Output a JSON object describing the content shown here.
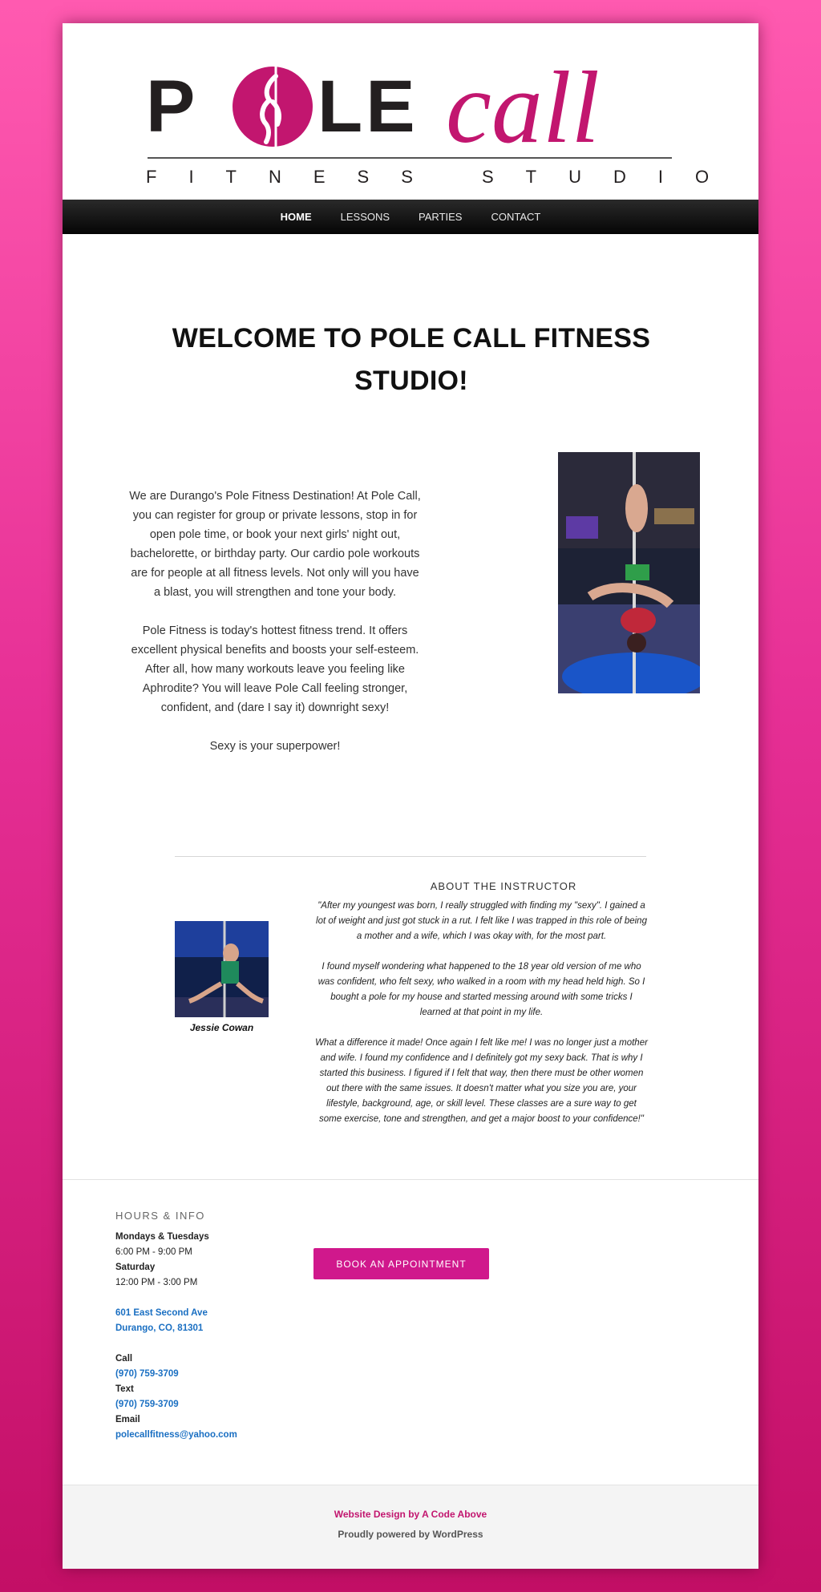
{
  "colors": {
    "brand_pink": "#c2166f",
    "button_pink": "#d0188c",
    "nav_bg": "#111111",
    "link_blue": "#1a6fc2"
  },
  "logo": {
    "word_pole": "POLE",
    "word_call": "call",
    "tagline": "FITNESS STUDIO"
  },
  "nav": {
    "items": [
      {
        "label": "HOME",
        "active": true
      },
      {
        "label": "LESSONS",
        "active": false
      },
      {
        "label": "PARTIES",
        "active": false
      },
      {
        "label": "CONTACT",
        "active": false
      }
    ]
  },
  "main": {
    "title": "WELCOME TO POLE CALL FITNESS STUDIO!",
    "intro": [
      "We are Durango's Pole Fitness Destination! At Pole Call, you can register for group or private lessons, stop in for open pole time, or book your next girls' night out, bachelorette, or birthday party. Our cardio pole workouts are for people at all fitness levels. Not only will you have a blast, you will strengthen and tone your body.",
      "Pole Fitness is today's hottest fitness trend. It offers excellent physical benefits and boosts your self-esteem. After all, how many workouts leave you feeling like Aphrodite? You will leave Pole Call feeling stronger, confident, and (dare I say it) downright sexy!",
      "Sexy is your superpower!"
    ]
  },
  "about": {
    "title": "ABOUT THE INSTRUCTOR",
    "instructor_name": "Jessie Cowan",
    "paragraphs": [
      "\"After my youngest was born, I really struggled with finding my \"sexy\". I gained a lot of weight and just got stuck in a rut. I felt like I was trapped in this role of being a mother and a wife, which I was okay with, for the most part.",
      "I found myself wondering what happened to the 18 year old version of me who was confident, who felt sexy, who walked in a room with my head held high. So I bought a pole for my house and started messing around with some tricks I learned at that point in my life.",
      "What a difference it made! Once again I felt like me! I was no longer just a mother and wife. I found my confidence and I definitely got my sexy back. That is why I started this business. I figured if I felt that way, then there must be other women out there with the same issues. It doesn't matter what you size you are, your lifestyle, background, age, or skill level. These classes are a sure way to get some exercise, tone and strengthen, and get a major boost to your confidence!\""
    ]
  },
  "hours": {
    "title": "HOURS & INFO",
    "day1": "Mondays & Tuesdays",
    "time1": "6:00 PM - 9:00 PM",
    "day2": "Saturday",
    "time2": "12:00 PM - 3:00 PM",
    "address1": "601 East Second Ave",
    "address2": "Durango, CO, 81301",
    "call_label": "Call",
    "call_number": "(970) 759-3709",
    "text_label": "Text",
    "text_number": "(970) 759-3709",
    "email_label": "Email",
    "email": "polecallfitness@yahoo.com"
  },
  "cta": {
    "book_label": "BOOK AN APPOINTMENT"
  },
  "footer": {
    "credit": "Website Design by A Code Above",
    "powered": "Proudly powered by WordPress"
  }
}
